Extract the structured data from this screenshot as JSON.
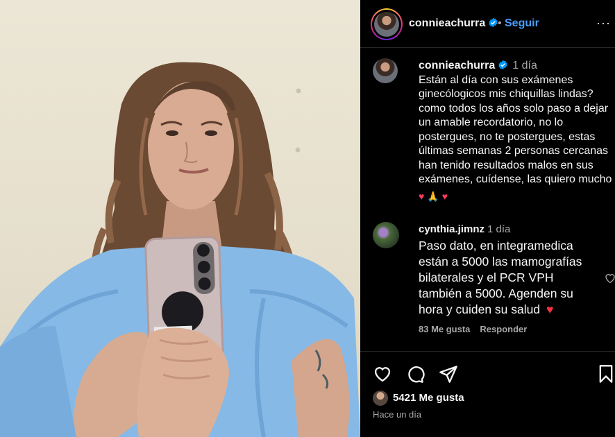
{
  "post": {
    "username": "connieachurra",
    "follow_label": "Seguir",
    "separator": "•",
    "more_label": "···",
    "caption_time": "1 día",
    "caption": "Están al día con sus exámenes ginecólogicos mis chiquillas lindas? como todos los años solo paso a dejar un amable recordatorio, no lo postergues, no te postergues, estas últimas semanas 2 personas cercanas han tenido resultados malos en sus exámenes, cuídense, las quiero mucho",
    "caption_emojis": [
      "heart-emoji",
      "folded-hands-emoji",
      "heart-emoji"
    ]
  },
  "comment": {
    "username": "cynthia.jimnz",
    "time": "1 día",
    "text": "Paso dato, en integramedica están a 5000 las mamografías bilaterales y el PCR VPH también a 5000. Agenden su hora y cuiden su salud",
    "text_emoji": "heart-emoji",
    "likes": "83 Me gusta",
    "reply_label": "Responder"
  },
  "footer": {
    "likes": "5421 Me gusta",
    "ago": "Hace un día"
  },
  "icons": {
    "like": "heart-outline-icon",
    "comment": "comment-bubble-icon",
    "share": "paper-plane-icon",
    "save": "bookmark-icon",
    "verified": "verified-badge-icon"
  },
  "colors": {
    "background": "#000000",
    "text": "#f5f5f5",
    "muted": "#a8a8a8",
    "link_blue": "#4a9dff",
    "verified": "#0095f6",
    "heart_red": "#ff3040"
  }
}
